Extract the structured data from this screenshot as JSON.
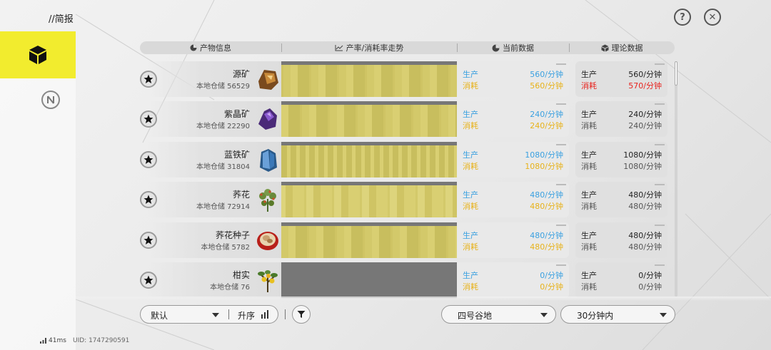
{
  "header_bar": {
    "title": "//简报",
    "help_glyph": "?",
    "close_glyph": "✕"
  },
  "accent_color": "#f2ec2e",
  "table": {
    "col_info": "产物信息",
    "col_trend": "产率/消耗率走势",
    "col_current": "当前数据",
    "col_theory": "理论数据"
  },
  "rows": [
    {
      "name": "源矿",
      "storage": "本地仓储 56529",
      "icon": "source-ore-icon",
      "has_trend": true,
      "cur_prod_label": "生产",
      "cur_prod": "560/分钟",
      "cur_cons_label": "消耗",
      "cur_cons": "560/分钟",
      "th_prod_label": "生产",
      "th_prod": "560/分钟",
      "th_cons_label": "消耗",
      "th_cons": "570/分钟",
      "th_cons_warn": true
    },
    {
      "name": "紫晶矿",
      "storage": "本地仓储 22290",
      "icon": "amethyst-ore-icon",
      "has_trend": true,
      "cur_prod_label": "生产",
      "cur_prod": "240/分钟",
      "cur_cons_label": "消耗",
      "cur_cons": "240/分钟",
      "th_prod_label": "生产",
      "th_prod": "240/分钟",
      "th_cons_label": "消耗",
      "th_cons": "240/分钟",
      "th_cons_warn": false
    },
    {
      "name": "蓝铁矿",
      "storage": "本地仓储 31804",
      "icon": "blue-iron-ore-icon",
      "has_trend": true,
      "cur_prod_label": "生产",
      "cur_prod": "1080/分钟",
      "cur_cons_label": "消耗",
      "cur_cons": "1080/分钟",
      "th_prod_label": "生产",
      "th_prod": "1080/分钟",
      "th_cons_label": "消耗",
      "th_cons": "1080/分钟",
      "th_cons_warn": false
    },
    {
      "name": "荞花",
      "storage": "本地仓储 72914",
      "icon": "buckwheat-flower-icon",
      "has_trend": true,
      "cur_prod_label": "生产",
      "cur_prod": "480/分钟",
      "cur_cons_label": "消耗",
      "cur_cons": "480/分钟",
      "th_prod_label": "生产",
      "th_prod": "480/分钟",
      "th_cons_label": "消耗",
      "th_cons": "480/分钟",
      "th_cons_warn": false
    },
    {
      "name": "荞花种子",
      "storage": "本地仓储 5782",
      "icon": "buckwheat-seed-icon",
      "has_trend": true,
      "cur_prod_label": "生产",
      "cur_prod": "480/分钟",
      "cur_cons_label": "消耗",
      "cur_cons": "480/分钟",
      "th_prod_label": "生产",
      "th_prod": "480/分钟",
      "th_cons_label": "消耗",
      "th_cons": "480/分钟",
      "th_cons_warn": false
    },
    {
      "name": "柑实",
      "storage": "本地仓储 76",
      "icon": "citrus-fruit-icon",
      "has_trend": false,
      "cur_prod_label": "生产",
      "cur_prod": "0/分钟",
      "cur_cons_label": "消耗",
      "cur_cons": "0/分钟",
      "th_prod_label": "生产",
      "th_prod": "0/分钟",
      "th_cons_label": "消耗",
      "th_cons": "0/分钟",
      "th_cons_warn": false
    }
  ],
  "controls": {
    "sort_selected": "默认",
    "order_label": "升序",
    "region_selected": "四号谷地",
    "time_selected": "30分钟内"
  },
  "status": {
    "ping": "41ms",
    "uid": "UID: 1747290591"
  }
}
